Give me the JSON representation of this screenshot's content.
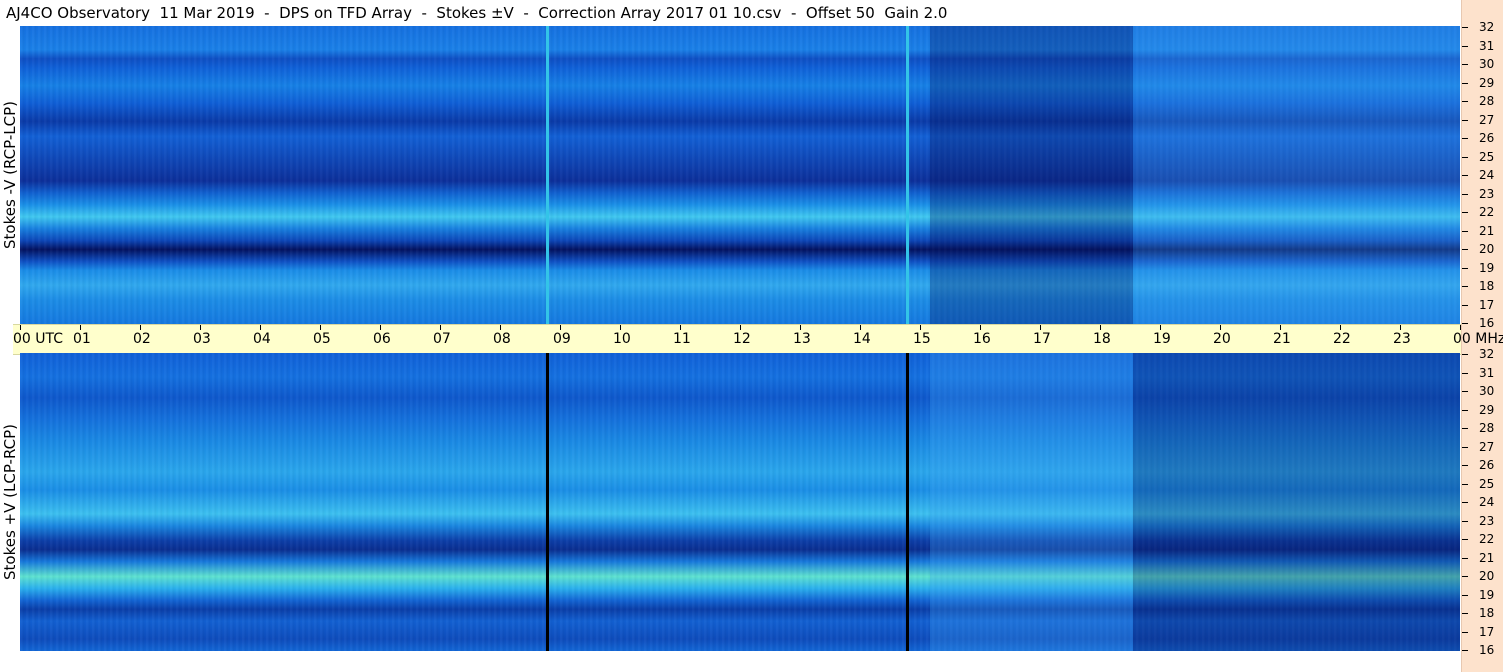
{
  "title": "AJ4CO Observatory  11 Mar 2019  -  DPS on TFD Array  -  Stokes ±V  -  Correction Array 2017 01 10.csv  -  Offset 50  Gain 2.0",
  "top_panel": {
    "ylabel": "Stokes -V (RCP-LCP)"
  },
  "bottom_panel": {
    "ylabel": "Stokes +V (LCP-RCP)"
  },
  "time_axis": {
    "labels": [
      "00  UTC",
      "01",
      "02",
      "03",
      "04",
      "05",
      "06",
      "07",
      "08",
      "09",
      "10",
      "11",
      "12",
      "13",
      "14",
      "15",
      "16",
      "17",
      "18",
      "19",
      "20",
      "21",
      "22",
      "23",
      "00 MHz"
    ]
  },
  "freq_axis": {
    "labels": [
      "32",
      "31",
      "30",
      "29",
      "28",
      "27",
      "26",
      "25",
      "24",
      "23",
      "22",
      "21",
      "20",
      "19",
      "18",
      "17",
      "16"
    ]
  },
  "colors": {
    "background": "#ffffff",
    "time_axis_bg": "#ffffcc",
    "right_strip_bg": "#fde2cc",
    "cyan_marker": "#33c4e8",
    "black_marker": "#000000"
  }
}
